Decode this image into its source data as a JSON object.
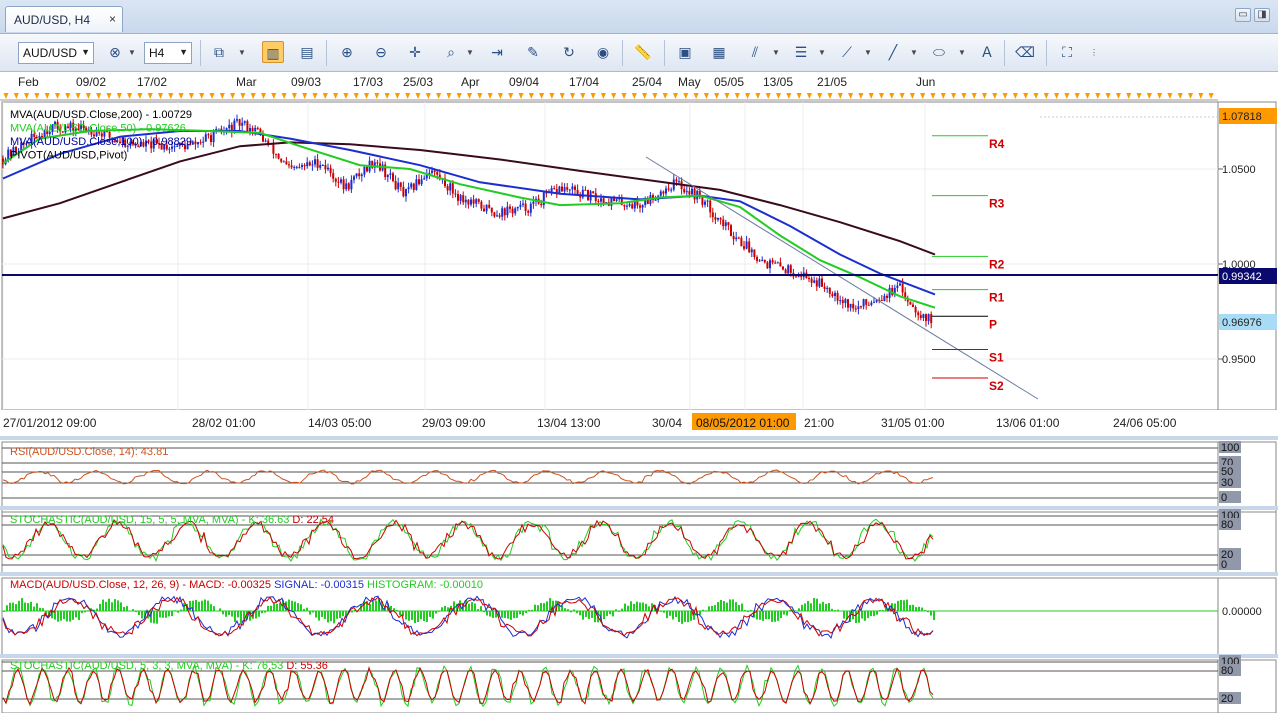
{
  "tab": {
    "title": "AUD/USD, H4",
    "close": "×"
  },
  "window_buttons": [
    "▭",
    "◨"
  ],
  "toolbar": {
    "symbol": "AUD/USD",
    "timeframe": "H4"
  },
  "top_axis_labels": [
    "Feb",
    "09/02",
    "17/02",
    "Mar",
    "09/03",
    "17/03",
    "25/03",
    "Apr",
    "09/04",
    "17/04",
    "25/04",
    "May",
    "05/05",
    "13/05",
    "21/05",
    "Jun"
  ],
  "bottom_axis_labels": [
    "27/01/2012 09:00",
    "28/02 01:00",
    "14/03 05:00",
    "29/03 09:00",
    "13/04 13:00",
    "30/04",
    "08/05/2012 01:00",
    "21:00",
    "31/05 01:00",
    "13/06 01:00",
    "24/06 05:00"
  ],
  "price_axis": {
    "ticks": [
      "1.0500",
      "1.0000",
      "0.9500"
    ],
    "high_label": "1.07818",
    "line_label": "0.99342",
    "current_label": "0.96976"
  },
  "main_legend": [
    {
      "text": "MVA(AUD/USD.Close,200) - 1.00729",
      "color": "#000000"
    },
    {
      "text": "MVA(AUD/USD.Close,50) - 0.97626",
      "color": "#22cc22"
    },
    {
      "text": "MVA(AUD/USD.Close,100) - 0.98829",
      "color": "#000099"
    },
    {
      "text": "PIVOT(AUD/USD,Pivot)",
      "color": "#000000"
    }
  ],
  "pivot_labels": [
    "R4",
    "R3",
    "R2",
    "R1",
    "P",
    "S1",
    "S2"
  ],
  "indicators": {
    "rsi": {
      "label": "RSI(AUD/USD.Close, 14): 43.81",
      "levels": [
        "100",
        "70",
        "50",
        "30",
        "0"
      ]
    },
    "stoch1": {
      "label": "STOCHASTIC(AUD/USD, 15, 5, 5, MVA, MVA) -",
      "k": "K: 36.63",
      "d": "D: 22.54",
      "levels": [
        "100",
        "80",
        "20",
        "0"
      ]
    },
    "macd": {
      "label": "MACD(AUD/USD.Close, 12, 26, 9) -",
      "macd": "MACD: -0.00325",
      "signal": "SIGNAL: -0.00315",
      "hist": "HISTOGRAM: -0.00010",
      "zero": "0.00000"
    },
    "stoch2": {
      "label": "STOCHASTIC(AUD/USD, 5, 3, 3, MVA, MVA) -",
      "k": "K: 76.53",
      "d": "D: 55.36",
      "levels": [
        "100",
        "80",
        "20"
      ]
    }
  },
  "colors": {
    "red": "#cc0000",
    "green": "#22cc22",
    "blue": "#1b2fd0",
    "maroon": "#3a0a1e",
    "rsi": "#cc5522",
    "navy": "#0a0a6e",
    "highlight": "#ff9900"
  }
}
